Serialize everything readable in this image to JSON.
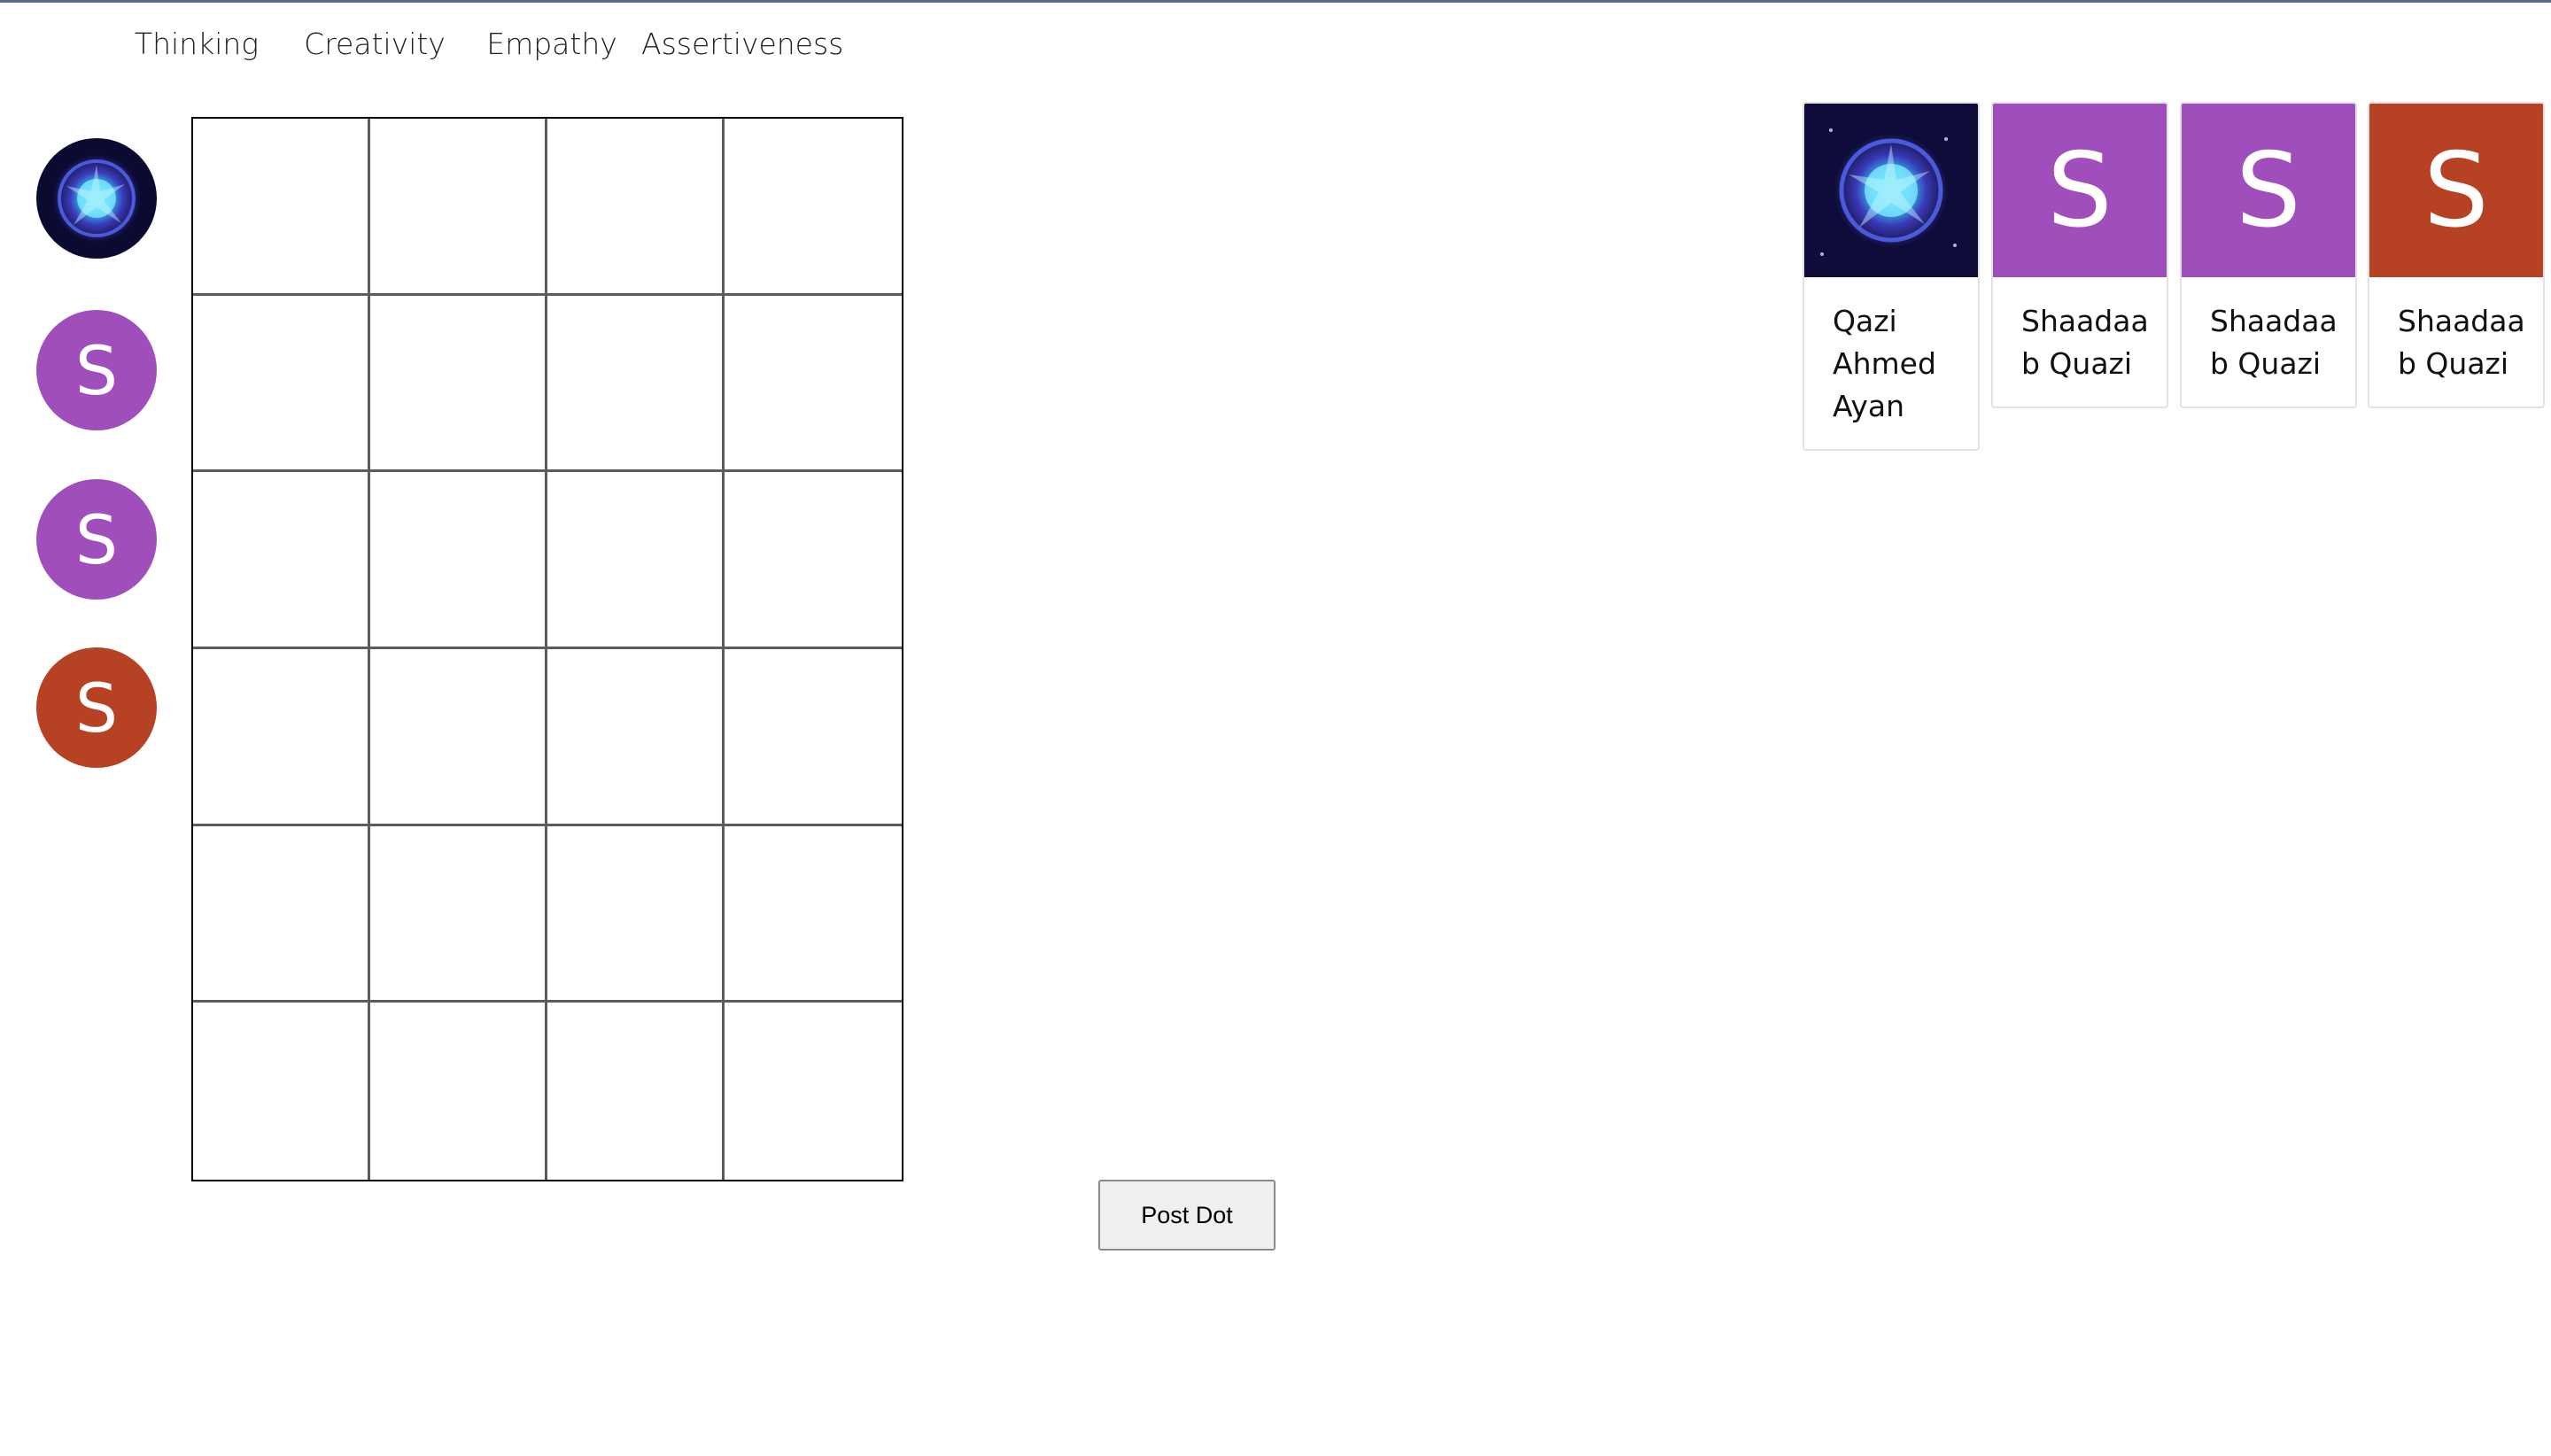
{
  "columns": [
    "Thinking",
    "Creativity",
    "Empathy",
    "Assertiveness"
  ],
  "rows": [
    {
      "avatar": "cosmic-photo",
      "letter": "",
      "color": "#1a1050"
    },
    {
      "avatar": "letter",
      "letter": "S",
      "color": "#a04ebb"
    },
    {
      "avatar": "letter",
      "letter": "S",
      "color": "#a04ebb"
    },
    {
      "avatar": "letter",
      "letter": "S",
      "color": "#b74223"
    }
  ],
  "action": {
    "post_label": "Post Dot"
  },
  "participants": [
    {
      "name": "Qazi Ahmed Ayan",
      "avatar": "cosmic-photo",
      "letter": "",
      "color": "#1a1050"
    },
    {
      "name": "Shaadaab Quazi",
      "avatar": "letter",
      "letter": "S",
      "color": "#a04ebb"
    },
    {
      "name": "Shaadaab Quazi",
      "avatar": "letter",
      "letter": "S",
      "color": "#a04ebb"
    },
    {
      "name": "Shaadaab Quazi",
      "avatar": "letter",
      "letter": "S",
      "color": "#b74223"
    }
  ]
}
